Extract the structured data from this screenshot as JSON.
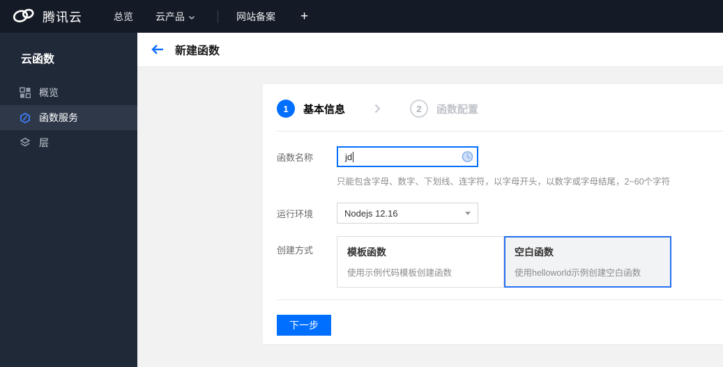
{
  "topbar": {
    "logo_text": "腾讯云",
    "nav": [
      {
        "label": "总览"
      },
      {
        "label": "云产品"
      },
      {
        "label": "网站备案"
      }
    ],
    "plus_label": "+"
  },
  "sidebar": {
    "title": "云函数",
    "items": [
      {
        "label": "概览",
        "icon": "grid-icon",
        "active": false
      },
      {
        "label": "函数服务",
        "icon": "scf-icon",
        "active": true
      },
      {
        "label": "层",
        "icon": "layers-icon",
        "active": false
      }
    ]
  },
  "header": {
    "title": "新建函数"
  },
  "wizard": {
    "steps": [
      {
        "number": "1",
        "label": "基本信息",
        "state": "active"
      },
      {
        "number": "2",
        "label": "函数配置",
        "state": "pending"
      }
    ]
  },
  "form": {
    "name": {
      "label": "函数名称",
      "value": "jd",
      "help": "只能包含字母、数字、下划线、连字符，以字母开头，以数字或字母结尾，2~60个字符",
      "status_icon": "clock-icon"
    },
    "runtime": {
      "label": "运行环境",
      "value": "Nodejs 12.16"
    },
    "method": {
      "label": "创建方式",
      "options": [
        {
          "title": "模板函数",
          "desc": "使用示例代码模板创建函数",
          "selected": false
        },
        {
          "title": "空白函数",
          "desc": "使用helloworld示例创建空白函数",
          "selected": true
        }
      ]
    }
  },
  "actions": {
    "next": "下一步"
  },
  "colors": {
    "accent": "#006eff",
    "topbar_bg": "#151b26",
    "sidebar_bg": "#202938",
    "sidebar_active_bg": "#2e3849",
    "selected_card_border": "#2470f0",
    "content_bg": "#f2f2f2"
  }
}
